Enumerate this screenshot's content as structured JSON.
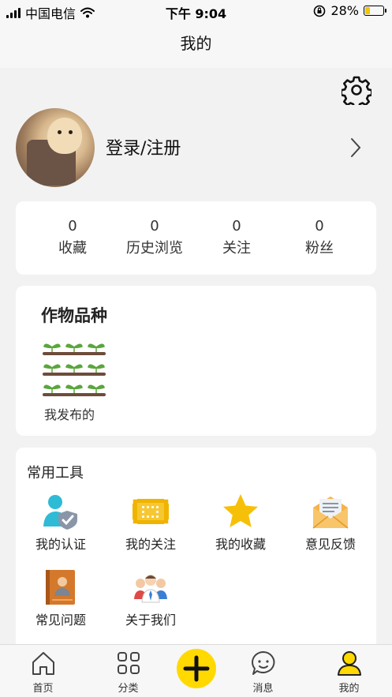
{
  "status_bar": {
    "carrier": "中国电信",
    "time": "下午 9:04",
    "battery": "28%",
    "battery_level": 0.28
  },
  "header": {
    "title": "我的"
  },
  "profile": {
    "login_label": "登录/注册"
  },
  "stats": [
    {
      "value": "0",
      "label": "收藏"
    },
    {
      "value": "0",
      "label": "历史浏览"
    },
    {
      "value": "0",
      "label": "关注"
    },
    {
      "value": "0",
      "label": "粉丝"
    }
  ],
  "crop_section": {
    "title": "作物品种",
    "item_label": "我发布的"
  },
  "tools": {
    "title": "常用工具",
    "items": [
      {
        "label": "我的认证",
        "icon": "user-shield-icon"
      },
      {
        "label": "我的关注",
        "icon": "scan-frame-icon"
      },
      {
        "label": "我的收藏",
        "icon": "star-icon"
      },
      {
        "label": "意见反馈",
        "icon": "envelope-icon"
      },
      {
        "label": "常见问题",
        "icon": "question-book-icon"
      },
      {
        "label": "关于我们",
        "icon": "team-icon"
      }
    ]
  },
  "tab_bar": {
    "items": [
      {
        "label": "首页",
        "icon": "home-icon"
      },
      {
        "label": "分类",
        "icon": "grid-icon"
      },
      {
        "label": "",
        "icon": "plus-icon"
      },
      {
        "label": "消息",
        "icon": "chat-icon"
      },
      {
        "label": "我的",
        "icon": "user-icon"
      }
    ],
    "active_index": 4
  },
  "colors": {
    "accent": "#FFD900",
    "background": "#F2F2F2",
    "card": "#FFFFFF",
    "plant_green": "#5aa63c",
    "soil_brown": "#6d4c3a"
  }
}
